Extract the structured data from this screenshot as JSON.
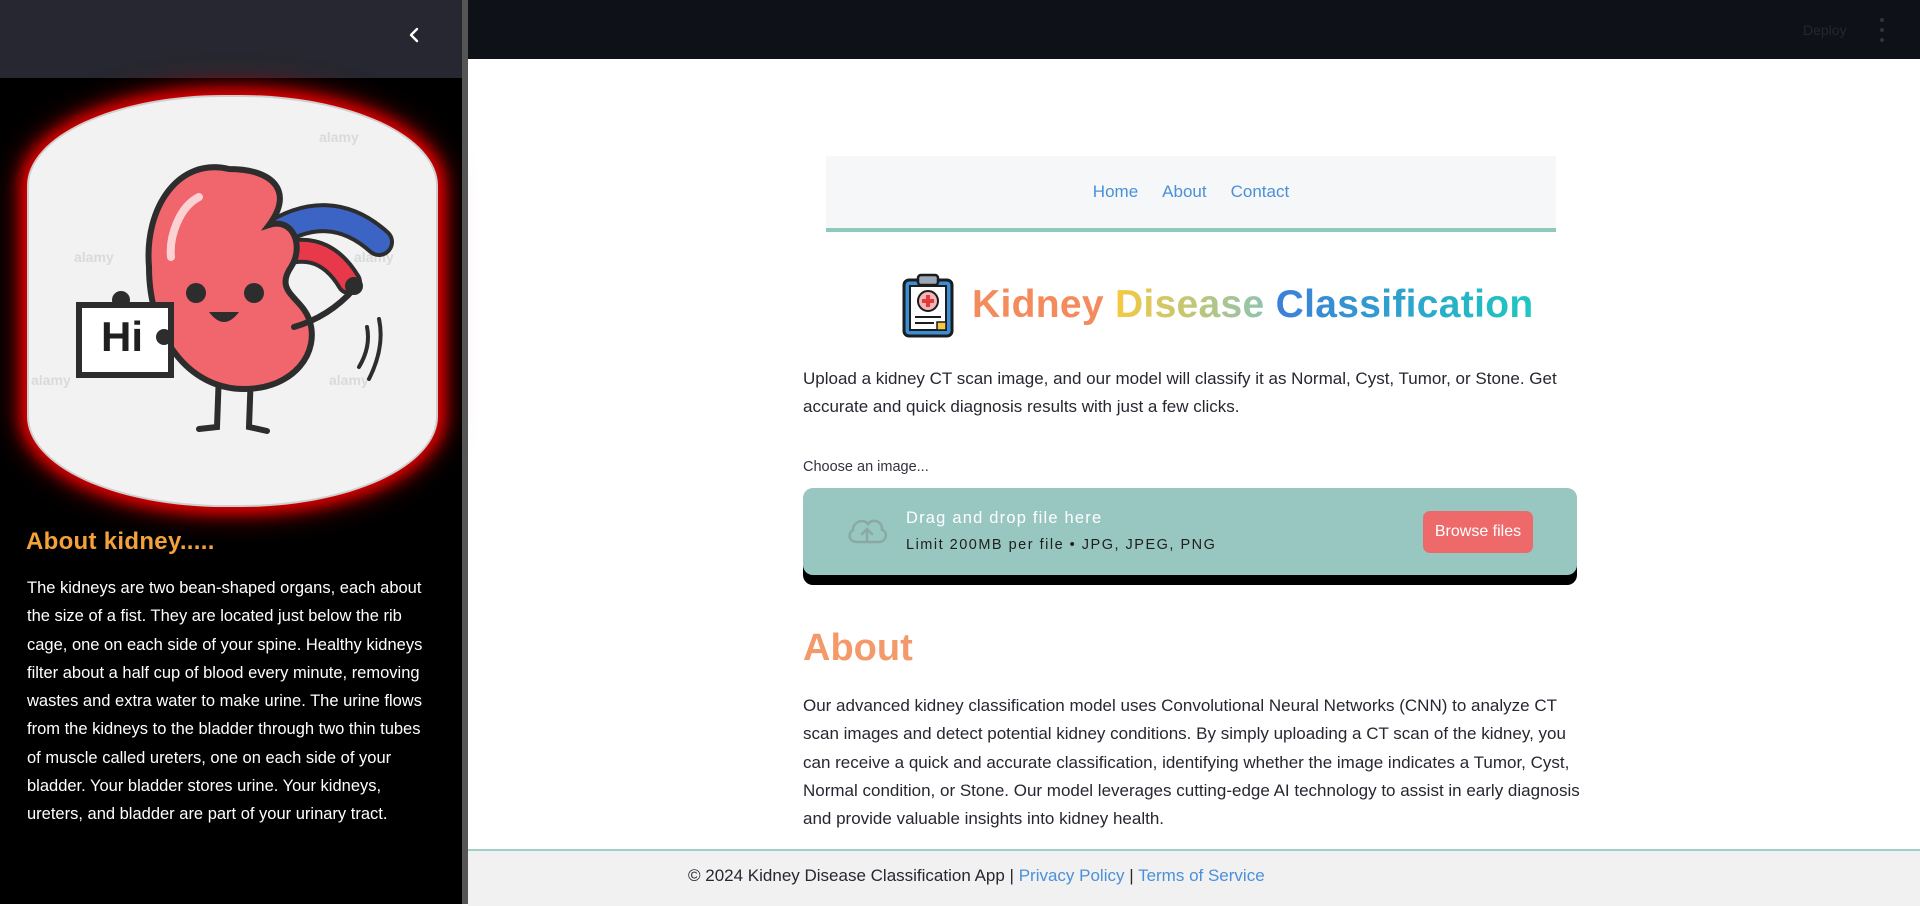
{
  "sidebar": {
    "collapse_icon": "chevron-left-icon",
    "illustration": {
      "sign_text": "Hi",
      "watermark": "alamy"
    },
    "about_title": "About kidney.....",
    "about_text": "The kidneys are two bean-shaped organs, each about the size of a fist. They are located just below the rib cage, one on each side of your spine. Healthy kidneys filter about a half cup of blood every minute, removing wastes and extra water to make urine. The urine flows from the kidneys to the bladder through two thin tubes of muscle called ureters, one on each side of your bladder. Your bladder stores urine. Your kidneys, ureters, and bladder are part of your urinary tract."
  },
  "header": {
    "deploy_label": "Deploy",
    "menu_icon": "vertical-dots-icon"
  },
  "nav": {
    "links": [
      "Home",
      "About",
      "Contact"
    ]
  },
  "title": {
    "icon": "clipboard-medical-icon",
    "words": [
      "Kidney",
      "Disease",
      "Classification"
    ],
    "colors": {
      "kidney": "#f48b5c",
      "disease_start": "#f6c93e",
      "disease_end": "#8fc3b0",
      "classification_start": "#3d7fd9",
      "classification_end": "#1ec8c0"
    }
  },
  "intro_text": "Upload a kidney CT scan image, and our model will classify it as Normal, Cyst, Tumor, or Stone. Get accurate and quick diagnosis results with just a few clicks.",
  "uploader": {
    "label": "Choose an image...",
    "icon": "cloud-upload-icon",
    "drop_text": "Drag and drop file here",
    "limit_text": "Limit 200MB per file • JPG, JPEG, PNG",
    "browse_label": "Browse files"
  },
  "about": {
    "heading": "About",
    "text": "Our advanced kidney classification model uses Convolutional Neural Networks (CNN) to analyze CT scan images and detect potential kidney conditions. By simply uploading a CT scan of the kidney, you can receive a quick and accurate classification, identifying whether the image indicates a Tumor, Cyst, Normal condition, or Stone. Our model leverages cutting-edge AI technology to assist in early diagnosis and provide valuable insights into kidney health."
  },
  "footer": {
    "copyright": "© 2024 Kidney Disease Classification App | ",
    "privacy_label": "Privacy Policy",
    "separator": " | ",
    "terms_label": "Terms of Service"
  },
  "colors": {
    "sidebar_bg": "#000000",
    "sidebar_top_bg": "#262730",
    "topbar_bg": "#0e1117",
    "accent_link": "#4a90d9",
    "uploader_bg": "#98c6c0",
    "browse_bg": "#ee6a6a",
    "about_heading": "#f49a6a",
    "about_kidney_title": "#f4a13a",
    "glow": "#e00000"
  }
}
